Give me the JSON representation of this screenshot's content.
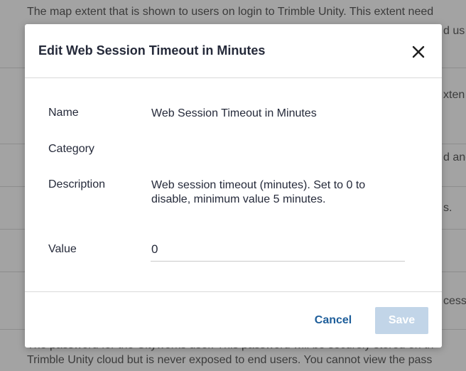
{
  "background": {
    "lines": [
      {
        "text": "The map extent that is shown to users on login to Trimble Unity. This extent need"
      },
      {
        "text": "d us"
      },
      {
        "text": "xten"
      },
      {
        "text": "d and"
      },
      {
        "text": "s."
      },
      {
        "text": "cessi"
      },
      {
        "text": "The password for the Cityworks user. This password will be securely stored on th"
      },
      {
        "text": "Trimble Unity cloud but is never exposed to end users. You cannot view the pass"
      }
    ]
  },
  "dialog": {
    "title": "Edit Web Session Timeout in Minutes",
    "close_icon": "close-icon",
    "fields": {
      "name_label": "Name",
      "name_value": "Web Session Timeout in Minutes",
      "category_label": "Category",
      "category_value": "",
      "description_label": "Description",
      "description_value": "Web session timeout (minutes). Set to 0 to disable, minimum value 5 minutes.",
      "value_label": "Value",
      "value_input": "0"
    },
    "buttons": {
      "cancel_label": "Cancel",
      "save_label": "Save"
    },
    "colors": {
      "title_text": "#252a3a",
      "cancel_text": "#1e5e9a",
      "save_disabled_bg": "#c2d5e8",
      "overlay": "#a3a3a3"
    }
  }
}
